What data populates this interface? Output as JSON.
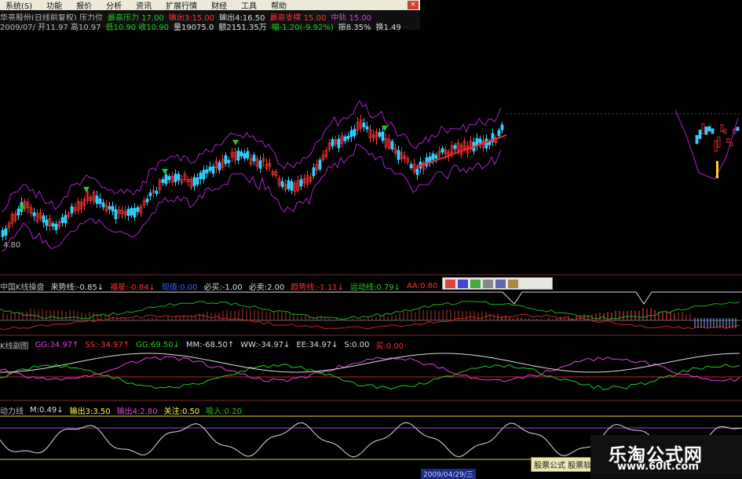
{
  "menu": {
    "items": [
      "系统(S)",
      "功能",
      "报价",
      "分析",
      "资讯",
      "扩展行情",
      "财经",
      "工具",
      "帮助"
    ],
    "close": "×"
  },
  "info": {
    "line1": [
      {
        "text": "华亮股份(日线前复权) 压力位",
        "color": "#bbbbbb"
      },
      {
        "text": "最高压力 17.00",
        "color": "#22cc22"
      },
      {
        "text": "输出3:15.00",
        "color": "#ff3333"
      },
      {
        "text": "输出4:16.50",
        "color": "#dddddd"
      },
      {
        "text": "最高支撑 15.00",
        "color": "#ff3333"
      },
      {
        "text": "中轨 15.00",
        "color": "#dd44dd"
      }
    ],
    "line2": [
      {
        "text": "2009/07/ 开11.97 高10.97",
        "color": "#bbbbbb"
      },
      {
        "text": "低10.90 收10.90",
        "color": "#22cc22"
      },
      {
        "text": "量19075.0",
        "color": "#dddddd"
      },
      {
        "text": "额2151.35万",
        "color": "#dddddd"
      },
      {
        "text": "幅-1.20(-9.92%)",
        "color": "#22cc22"
      },
      {
        "text": "振8.35%",
        "color": "#dddddd"
      },
      {
        "text": "换1.49",
        "color": "#dddddd"
      }
    ]
  },
  "price_label": "4.80",
  "panels": {
    "p2": [
      {
        "text": "中国K线操盘",
        "color": "#bbbbbb"
      },
      {
        "text": "来势线:-0.85↓",
        "color": "#dddddd"
      },
      {
        "text": "福星:-0.84↓",
        "color": "#ff3333"
      },
      {
        "text": "现值:0.00",
        "color": "#3366ff"
      },
      {
        "text": "必买:-1.00",
        "color": "#dddddd"
      },
      {
        "text": "必卖:2.00",
        "color": "#dddddd"
      },
      {
        "text": "趋势线:-1.11↓",
        "color": "#ff3333"
      },
      {
        "text": "运动线:0.79↓",
        "color": "#22cc22"
      },
      {
        "text": "AA:0.80",
        "color": "#ff3333"
      }
    ],
    "p3": [
      {
        "text": "K线副图",
        "color": "#bbbbbb"
      },
      {
        "text": "GG:34.97↑",
        "color": "#dd44dd"
      },
      {
        "text": "SS:-34.97↑",
        "color": "#ff3333"
      },
      {
        "text": "GG:69.50↓",
        "color": "#22cc22"
      },
      {
        "text": "MM:-68.50↑",
        "color": "#dddddd"
      },
      {
        "text": "WW:-34.97↓",
        "color": "#dddddd"
      },
      {
        "text": "EE:34.97↓",
        "color": "#dddddd"
      },
      {
        "text": "S:0.00",
        "color": "#dddddd"
      },
      {
        "text": "买:0.00",
        "color": "#ff3333"
      }
    ],
    "p4": [
      {
        "text": "动力线",
        "color": "#bbbbbb"
      },
      {
        "text": "M:0.49↓",
        "color": "#dddddd"
      },
      {
        "text": "输出3:3.50",
        "color": "#ffff44"
      },
      {
        "text": "输出4:2.80",
        "color": "#dd44dd"
      },
      {
        "text": "关注:0.50",
        "color": "#ffff44"
      },
      {
        "text": "吸入:0.20",
        "color": "#22cc22"
      }
    ]
  },
  "date_tag": "2009/04/29/三",
  "tip": "股票公式 股票软件",
  "watermark": {
    "title": "乐淘公式网",
    "url": "www.60lt.com"
  },
  "colors": {
    "up": "#ff3333",
    "down": "#33ccff",
    "band": "#aa22cc",
    "trend": "#ff2222"
  }
}
